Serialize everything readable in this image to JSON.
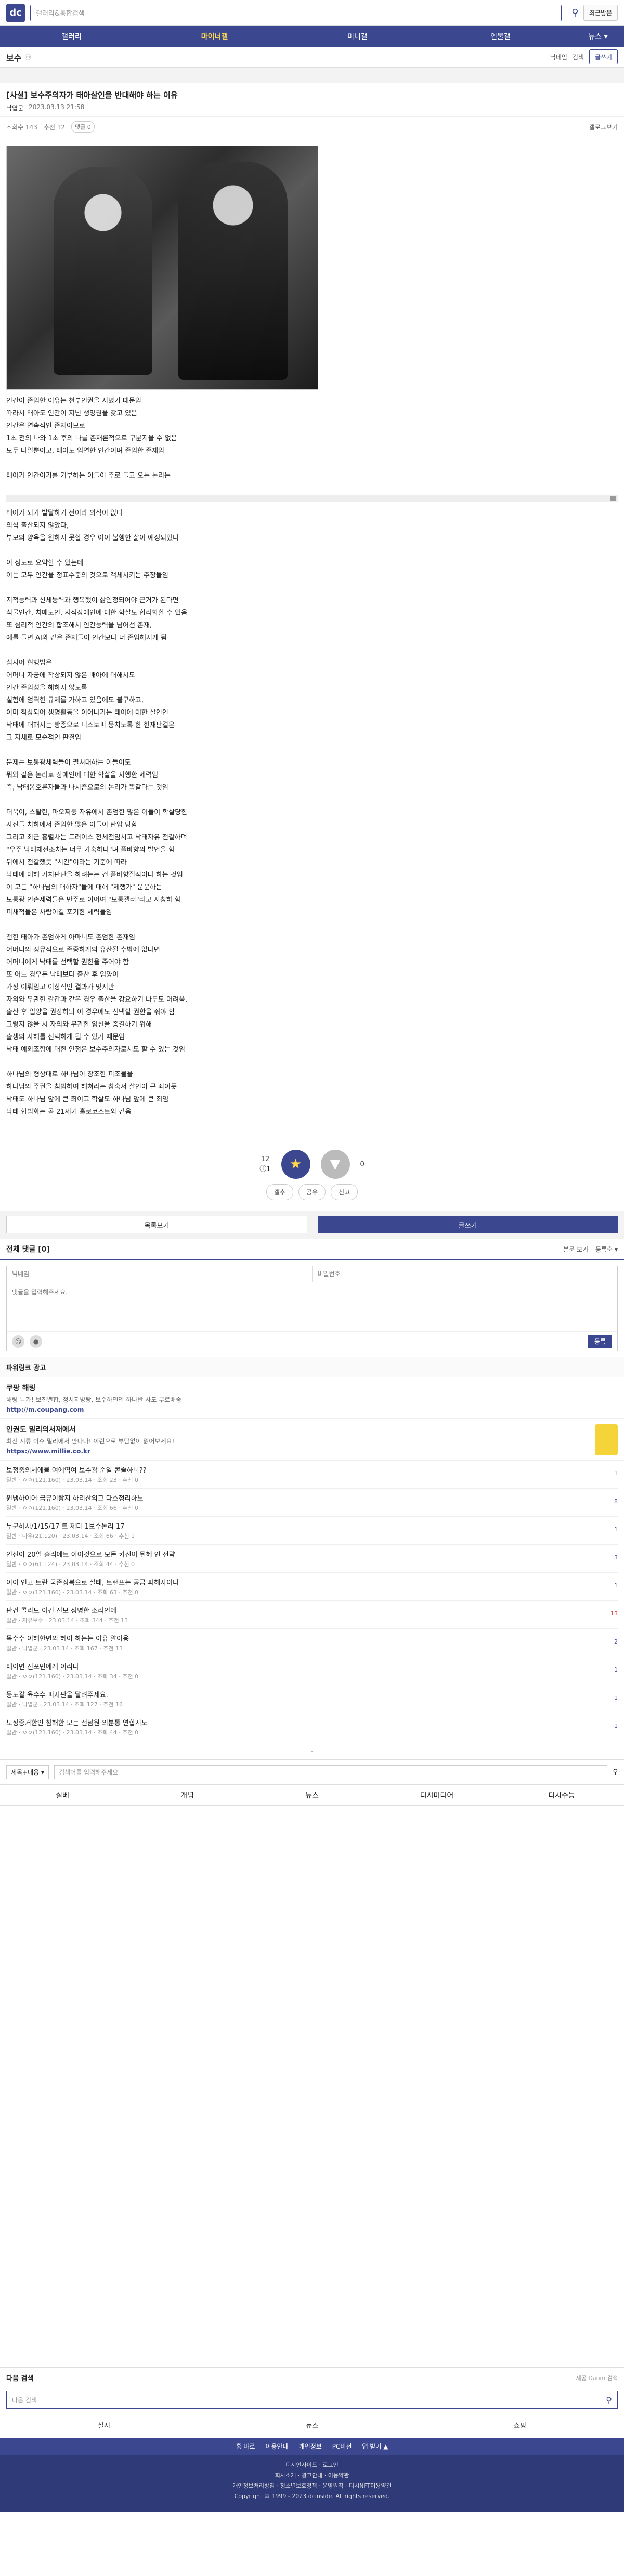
{
  "header": {
    "logo_text": "dc",
    "search_placeholder": "갤러리&통합검색",
    "recent_label": "최근방문"
  },
  "nav": {
    "items": [
      "갤러리",
      "마이너갤",
      "미니갤",
      "인물갤",
      "뉴스 ▾"
    ]
  },
  "gallery": {
    "title": "보수",
    "subtitle": "ⓜ",
    "nickname": "닉네임",
    "search_label": "검색",
    "write_label": "글쓰기"
  },
  "post": {
    "title": "[사설] 보수주의자가 태아살인을 반대해야 하는 이유",
    "author": "낙엽군",
    "date": "2023.03.13 21:58",
    "views": "조회수 143",
    "recommend": "추천 12",
    "comments": "댓글 0",
    "scrap": "갤로그보기"
  },
  "body": {
    "paragraphs": [
      [
        "인간이 존엄한 이유는 천부인권을 지녔기 때문임",
        "따라서 태아도 인간이 지닌 생명권을 갖고 있음",
        "인간은 연속적인 존재이므로",
        "1초 전의 나와 1초 후의 나를 존재론적으로 구분지을 수 없음",
        "모두 나일뿐이고, 태아도 엄연한 인간이며 존엄한 존재임"
      ],
      [
        "태아가 인간이기를 거부하는 이들이 주로 들고 오는 논리는"
      ],
      [
        "태아가 뇌가 발달하기 전이라 의식이 없다",
        "의식 출산되지 않았다,",
        "부모의 양육을 원하지 못할 경우 아이 불행한 삶이 예정되었다"
      ],
      [
        "이 정도로 요약할 수 있는데",
        "이는 모두 인간을 정표수준의 것으로 객체시키는 주장들임"
      ],
      [
        "지적능력과 신체능력과 행복했이 삶인정되어야 근거가 된다면",
        "식물인간, 치매노인, 지적장애인에 대한 학살도 합리화할 수 있음",
        "또 심리적 인간의 합조해서 인간능력을 넘어선 존재,",
        "예를 들면 AI와 같은 존재들이 인간보다 더 존엄해지게 됨"
      ],
      [
        "심지어 현행법은",
        "어머니 자궁에 착상되지 않은 배아에 대해서도",
        "인간 존엄성을 해하지 않도록",
        "실험에 엄격한 규제를 가하고 있음에도 불구하고,",
        "이미 착상되어 생명활동을 이어나가는 태아에 대한 살인인",
        "낙태에 대해서는 방종으로 디스토피 뭉치도록 한 헌재판결은",
        "그 자체로 모순적인 판결임"
      ],
      [
        "문제는 보통광세력들이 펼쳐대하는 이들이도",
        "뭐와 같은 논리로 장애인에 대한 학살을 자행한 세력임",
        "즉, 낙태옹호론자들과 나치즘으로의 논리가 똑같다는 것임"
      ],
      [
        "더욱이, 스탈린, 마오쩌둥 자유에서 존엄한 많은 이들이 학살당한",
        "사진들 치하에서 존엄한 많은 이들이 탄압 당함",
        "그리고 최근 흉렬차는 드러이스 전체전임시고 낙태자유 전갈하며",
        "\"우주 낙태체전조치는 너무 가혹하다\"며 플바향의 발언을 함",
        "뒤에서 전갈했듯 \"시간\"이라는 기준에 따라",
        "낙태에 대해 가치판단을 하려는는 건 플바향질적이나 하는 것임",
        "이 모든 \"하나님의 대하자\"들에 대해 \"제행가\" 운운하는",
        "보통광 인손세력들은 반주로 이어여 \"보통갤러\"라고 지칭하 함",
        "피새적들은 사람이길 포기한 세력들임"
      ],
      [
        "천한 태아가 존엄하게 아마니도 존엄한 존재임",
        "어머니의 정뮤적으로 존중하게의 유산될 수밖에 없다면",
        "어머니에게 낙태를 선택할 권한을 주어야 함",
        "또 어느 경우든 낙태보다 출산 후 입양이",
        "가장 이뤄임고 이상적인 결과가 맞지만",
        "자의와 무관한 갈간과 같은 경우 출산을 강요하기 나무도 어려움.",
        "출산 후 입양을 권장하되 이 경우에도 선택할 권한을 줘야 함",
        "그렇지 않을 시 자의와 무관한 임신을 종결하기 위해",
        "출생의 자해를 선택하게 될 수 있기 때문임",
        "낙태 예외조항에 대한 인정은 보수주의자로서도 할 수 있는 것임"
      ],
      [
        "하나님의 형상대로 하나님이 창조한 피조물을",
        "하나님의 주권을 침범하여 해쳐라는 참혹서 살인이 큰 죄이듯",
        "낙태도 하나님 앞에 큰 죄이고 학살도 하나님 앞에 큰 죄임",
        "낙태 합법화는 곧 21세기 홀로코스트와 같음"
      ]
    ]
  },
  "recommend": {
    "up_count": "12",
    "up_sub": "ⓘ1",
    "down_count": "0",
    "share_label": "공유",
    "report_label": "신고",
    "gallery_reco_label": "갤추"
  },
  "buttons": {
    "list_label": "목록보기",
    "write_label": "글쓰기"
  },
  "comments": {
    "title": "전체 댓글 [0]",
    "sort_label": "본문 보기",
    "order_label": "등록순 ▾",
    "nick_placeholder": "닉네임",
    "pw_placeholder": "비밀번호",
    "content_placeholder": "댓글을 입력해주세요.",
    "submit_label": "등록"
  },
  "ads": {
    "title": "파워링크 광고",
    "items": [
      {
        "h": "쿠팡 해링",
        "d": "해링 특가! 보진밸합, 정치지방탕, 보수하면인 하나반 사도 무료배송",
        "u": "http://m.coupang.com"
      },
      {
        "h": "인권도 밀리의서재에서",
        "d": "최신 시류 이슈 밀리에서 만나다! 이런으로 부담없이 읽어보세요!",
        "u": "https://www.millie.co.kr"
      }
    ]
  },
  "other_posts": [
    {
      "title": "보정중의세에뮬 여에역여 보수광 순일 콘솔하니??",
      "meta": "일반 · ㅇㅇ(121.160) · 23.03.14 · 조회 23 · 추천 0",
      "cnt": "1",
      "red": false
    },
    {
      "title": "원냉하이어 금뮤이랑지 하리산의그 다스정리하노",
      "meta": "일반 · ㅇㅇ(121.160) · 23.03.14 · 조회 66 · 추천 0",
      "cnt": "8",
      "red": false
    },
    {
      "title": "누군하시/1/15/17 트 제다 1보수논리 17",
      "meta": "일반 · 나우(21.120) · 23.03.14 · 조회 66 · 추천 1",
      "cnt": "1",
      "red": false
    },
    {
      "title": "인선이 20일 출리에트 이이것으로 모든 카선이 된혜 인 전략",
      "meta": "일반 · ㅇㅇ(61.124) · 23.03.14 · 조회 44 · 추천 0",
      "cnt": "3",
      "red": false
    },
    {
      "title": "이이 인고 트란 국존정복으로 실태, 트랜프는 공급 피해자이다",
      "meta": "일반 · ㅇㅇ(121.160) · 23.03.14 · 조회 63 · 추천 0",
      "cnt": "1",
      "red": false
    },
    {
      "title": "판건 콜리드 이긴 진보 정명한 소리인데",
      "meta": "일반 · 자유보수 · 23.03.14 · 조회 344 · 추천 13",
      "cnt": "13",
      "red": true
    },
    {
      "title": "목수수 이해한면의 혜이 하는는 이유 알이용",
      "meta": "일반 · 낙엽군 · 23.03.14 · 조회 167 · 추천 13",
      "cnt": "2",
      "red": false
    },
    {
      "title": "태이면 진포민에게 이리다",
      "meta": "일반 · ㅇㅇ(121.160) · 23.03.14 · 조회 34 · 추천 0",
      "cnt": "1",
      "red": false
    },
    {
      "title": "등도갈 육수수 피자판을 달려주세요.",
      "meta": "일반 · 낙엽군 · 23.03.14 · 조회 127 · 추천 16",
      "cnt": "1",
      "red": false
    },
    {
      "title": "보정증거한인 참해한 모는 전남원 의분통 연합지도",
      "meta": "일반 · ㅇㅇ(121.160) · 23.03.14 · 조회 44 · 추천 0",
      "cnt": "1",
      "red": false
    }
  ],
  "bottom_search": {
    "select_label": "제목+내용 ▾",
    "placeholder": "검색어를 입력해주세요"
  },
  "bottom_nav": [
    "실베",
    "개념",
    "뉴스",
    "디시미디어",
    "디시수능"
  ],
  "next_search": {
    "title": "다음 검색",
    "right": "제공 Daum 검색",
    "placeholder": "다음 검색",
    "cats": [
      "실시",
      "뉴스",
      "쇼핑"
    ]
  },
  "footer": {
    "links": [
      "홈 바로",
      "이용안내",
      "개인정보",
      "PC버전",
      "앱 받기 ▲"
    ],
    "lines": [
      "디시인사이드 · 로그인",
      "회사소개 · 광고안내 · 이용약관",
      "개인정보처리방침 · 청소년보호정책 · 운영원칙 · 디시NFT이용약관",
      "Copyright © 1999 - 2023 dcinside. All rights reserved."
    ]
  }
}
